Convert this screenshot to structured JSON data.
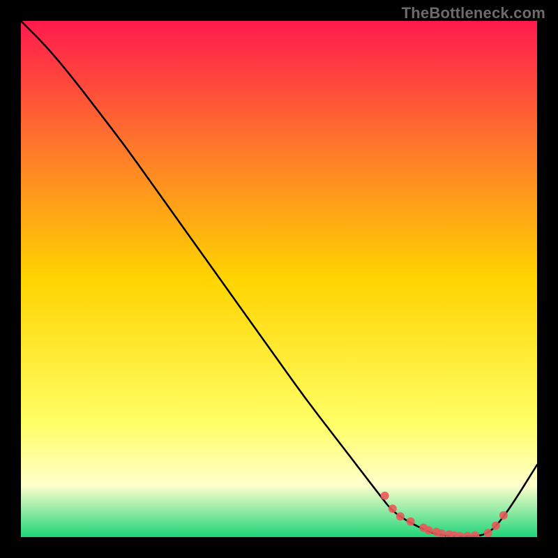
{
  "watermark": "TheBottleneck.com",
  "chart_data": {
    "type": "line",
    "title": "",
    "xlabel": "",
    "ylabel": "",
    "xlim": [
      0,
      100
    ],
    "ylim": [
      0,
      100
    ],
    "background_gradient": {
      "top": "#ff1a4d",
      "mid_upper": "#ff7a2a",
      "mid": "#ffd400",
      "lower_a": "#ffff66",
      "lower_b": "#ffffcc",
      "bottom": "#1fd57a"
    },
    "series": [
      {
        "name": "curve",
        "color": "#000000",
        "x": [
          0,
          5,
          10,
          15,
          20,
          25,
          30,
          35,
          40,
          45,
          50,
          55,
          60,
          65,
          70,
          72,
          75,
          78,
          80,
          82,
          85,
          88,
          90,
          92,
          95,
          100
        ],
        "y": [
          100,
          95,
          89,
          82.5,
          76,
          69,
          62,
          55,
          48,
          41,
          34,
          27,
          20.5,
          14,
          7.5,
          5,
          3,
          1.5,
          0.7,
          0.3,
          0.1,
          0.2,
          0.5,
          2,
          6,
          14
        ]
      }
    ],
    "markers": {
      "name": "bottleneck-points",
      "color": "#e85a5a",
      "radius_px": 6,
      "x": [
        70.5,
        72,
        73.5,
        75.5,
        78,
        79,
        80.5,
        81.5,
        83,
        84,
        85,
        86.5,
        88,
        90.5,
        92,
        93.5
      ],
      "y": [
        8,
        5.5,
        4,
        3,
        1.8,
        1.3,
        1,
        0.7,
        0.5,
        0.3,
        0.2,
        0.2,
        0.3,
        0.8,
        2.2,
        4.2
      ]
    }
  }
}
